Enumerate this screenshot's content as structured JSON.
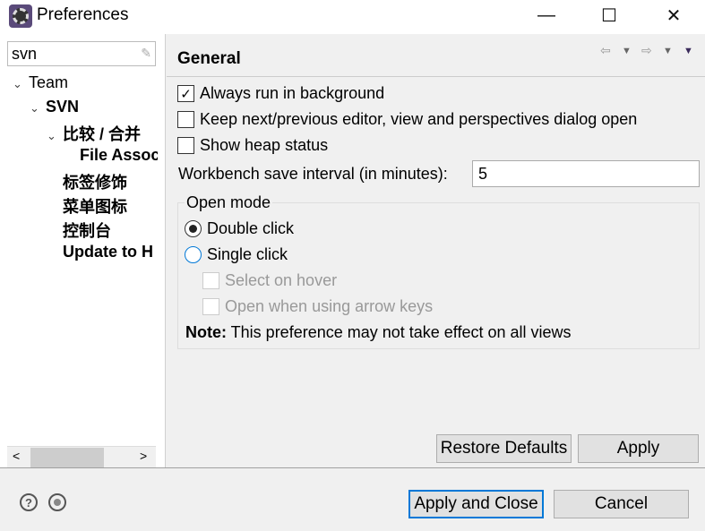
{
  "window": {
    "title": "Preferences",
    "minimize": "—",
    "maximize": "☐",
    "close": "✕"
  },
  "filter": {
    "value": "svn"
  },
  "tree": [
    {
      "label": "Team",
      "level": 0,
      "expanded": true,
      "bold": false
    },
    {
      "label": "SVN",
      "level": 1,
      "expanded": true,
      "bold": true
    },
    {
      "label": "比较 / 合并",
      "level": 2,
      "expanded": true,
      "bold": true
    },
    {
      "label": "File Assoc",
      "level": 3,
      "bold": true
    },
    {
      "label": "标签修饰",
      "level": 2,
      "bold": true
    },
    {
      "label": "菜单图标",
      "level": 2,
      "bold": true
    },
    {
      "label": "控制台",
      "level": 2,
      "bold": true
    },
    {
      "label": "Update to H",
      "level": 2,
      "bold": true
    }
  ],
  "page": {
    "title": "General",
    "always_run_bg": {
      "label": "Always run in background",
      "checked": true
    },
    "keep_dialog": {
      "label": "Keep next/previous editor, view and perspectives dialog open",
      "checked": false
    },
    "heap_status": {
      "label": "Show heap status",
      "checked": false
    },
    "save_interval": {
      "label": "Workbench save interval (in minutes):",
      "value": "5"
    },
    "open_mode": {
      "label": "Open mode",
      "double": "Double click",
      "single": "Single click",
      "selected": "double",
      "hover": "Select on hover",
      "arrow": "Open when using arrow keys"
    },
    "note_bold": "Note:",
    "note": " This preference may not take effect on all views",
    "restore": "Restore Defaults",
    "apply": "Apply"
  },
  "footer": {
    "apply_close": "Apply and Close",
    "cancel": "Cancel",
    "help": "?",
    "accent": "#0078d7"
  }
}
